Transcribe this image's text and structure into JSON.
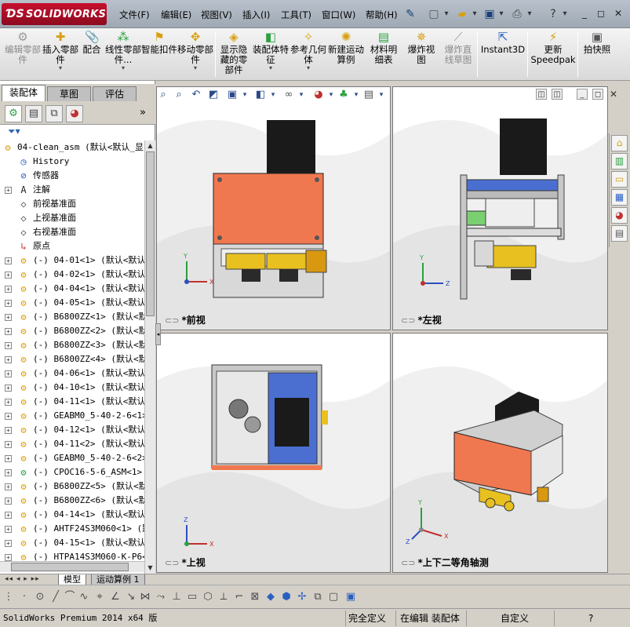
{
  "app": {
    "logo_text": "SOLIDWORKS",
    "menus": [
      "文件(F)",
      "编辑(E)",
      "视图(V)",
      "插入(I)",
      "工具(T)",
      "窗口(W)",
      "帮助(H)"
    ]
  },
  "quick_access": {
    "icons": [
      "pin-icon",
      "new-icon",
      "open-icon",
      "save-icon",
      "print-icon",
      "help-icon"
    ]
  },
  "window_controls": {
    "minimize": "_",
    "restore": "◻",
    "close": "✕"
  },
  "command_manager": [
    {
      "label": "编辑零部件",
      "icon": "edit-component-icon",
      "enabled": false,
      "dropdown": false
    },
    {
      "label": "插入零部件",
      "icon": "insert-component-icon",
      "enabled": true,
      "dropdown": true
    },
    {
      "label": "配合",
      "icon": "mate-icon",
      "enabled": true,
      "dropdown": false
    },
    {
      "label": "线性零部件...",
      "icon": "linear-pattern-icon",
      "enabled": true,
      "dropdown": true
    },
    {
      "label": "智能扣件",
      "icon": "smart-fasteners-icon",
      "enabled": true,
      "dropdown": false
    },
    {
      "label": "移动零部件",
      "icon": "move-component-icon",
      "enabled": true,
      "dropdown": true
    },
    {
      "label": "显示隐藏的零部件",
      "icon": "show-hidden-icon",
      "enabled": true,
      "dropdown": false
    },
    {
      "label": "装配体特征",
      "icon": "assembly-features-icon",
      "enabled": true,
      "dropdown": true
    },
    {
      "label": "参考几何体",
      "icon": "reference-geometry-icon",
      "enabled": true,
      "dropdown": true
    },
    {
      "label": "新建运动算例",
      "icon": "new-motion-study-icon",
      "enabled": true,
      "dropdown": false
    },
    {
      "label": "材料明细表",
      "icon": "bom-icon",
      "enabled": true,
      "dropdown": false
    },
    {
      "label": "爆炸视图",
      "icon": "exploded-view-icon",
      "enabled": true,
      "dropdown": false
    },
    {
      "label": "爆炸直线草图",
      "icon": "explode-line-sketch-icon",
      "enabled": false,
      "dropdown": false
    },
    {
      "label": "Instant3D",
      "icon": "instant3d-icon",
      "enabled": true,
      "dropdown": false
    },
    {
      "label": "更新Speedpak",
      "icon": "speedpak-icon",
      "enabled": true,
      "dropdown": false
    },
    {
      "label": "拍快照",
      "icon": "snapshot-icon",
      "enabled": true,
      "dropdown": false
    }
  ],
  "panel_tabs": [
    "装配体",
    "草图",
    "评估"
  ],
  "feature_tree": {
    "root": "04-clean_asm  (默认<默认_显",
    "items": [
      {
        "label": "History",
        "icon": "history-icon",
        "expandable": false
      },
      {
        "label": "传感器",
        "icon": "sensor-icon",
        "expandable": false
      },
      {
        "label": "注解",
        "icon": "annotation-icon",
        "expandable": true
      },
      {
        "label": "前视基准面",
        "icon": "plane-icon",
        "expandable": false
      },
      {
        "label": "上视基准面",
        "icon": "plane-icon",
        "expandable": false
      },
      {
        "label": "右视基准面",
        "icon": "plane-icon",
        "expandable": false
      },
      {
        "label": "原点",
        "icon": "origin-icon",
        "expandable": false
      },
      {
        "label": "(-) 04-01<1> (默认<默认",
        "icon": "part-icon",
        "expandable": true
      },
      {
        "label": "(-) 04-02<1> (默认<默认",
        "icon": "part-icon",
        "expandable": true
      },
      {
        "label": "(-) 04-04<1> (默认<默认",
        "icon": "part-icon",
        "expandable": true
      },
      {
        "label": "(-) 04-05<1> (默认<默认",
        "icon": "part-icon",
        "expandable": true
      },
      {
        "label": "(-) B6800ZZ<1> (默认<默",
        "icon": "part-icon",
        "expandable": true
      },
      {
        "label": "(-) B6800ZZ<2> (默认<默",
        "icon": "part-icon",
        "expandable": true
      },
      {
        "label": "(-) B6800ZZ<3> (默认<默",
        "icon": "part-icon",
        "expandable": true
      },
      {
        "label": "(-) B6800ZZ<4> (默认<默",
        "icon": "part-icon",
        "expandable": true
      },
      {
        "label": "(-) 04-06<1> (默认<默认",
        "icon": "part-icon",
        "expandable": true
      },
      {
        "label": "(-) 04-10<1> (默认<默认",
        "icon": "part-icon",
        "expandable": true
      },
      {
        "label": "(-) 04-11<1> (默认<默认",
        "icon": "part-icon",
        "expandable": true
      },
      {
        "label": "(-) GEABM0_5-40-2-6<1>",
        "icon": "part-icon",
        "expandable": true
      },
      {
        "label": "(-) 04-12<1> (默认<默认",
        "icon": "part-icon",
        "expandable": true
      },
      {
        "label": "(-) 04-11<2> (默认<默认",
        "icon": "part-icon",
        "expandable": true
      },
      {
        "label": "(-) GEABM0_5-40-2-6<2>",
        "icon": "part-icon",
        "expandable": true
      },
      {
        "label": "(-) CPOC16-5-6_ASM<1> (",
        "icon": "subassembly-icon",
        "expandable": true
      },
      {
        "label": "(-) B6800ZZ<5> (默认<默",
        "icon": "part-icon",
        "expandable": true
      },
      {
        "label": "(-) B6800ZZ<6> (默认<默",
        "icon": "part-icon",
        "expandable": true
      },
      {
        "label": "(-) 04-14<1> (默认<默认",
        "icon": "part-icon",
        "expandable": true
      },
      {
        "label": "(-) AHTF24S3M060<1> (默",
        "icon": "part-icon",
        "expandable": true
      },
      {
        "label": "(-) 04-15<1> (默认<默认",
        "icon": "part-icon",
        "expandable": true
      },
      {
        "label": "(-) HTPA14S3M060-K-P6<1",
        "icon": "part-icon",
        "expandable": true
      }
    ]
  },
  "viewports": [
    {
      "id": "front",
      "label": "*前视"
    },
    {
      "id": "left",
      "label": "*左视"
    },
    {
      "id": "top",
      "label": "*上视"
    },
    {
      "id": "iso",
      "label": "*上下二等角轴测"
    }
  ],
  "bottom_tabs": [
    "模型",
    "运动算例 1"
  ],
  "status_bar": {
    "app_version": "SolidWorks Premium 2014 x64 版",
    "state": "完全定义",
    "editing": "在编辑 装配体",
    "units": "自定义",
    "help": "?"
  },
  "colors": {
    "accent": "#c8102e",
    "copper_plate": "#f07850",
    "motor_black": "#1a1a1a",
    "blue_part": "#4a6fd0",
    "yellow_part": "#e8c020",
    "green_part": "#7ad070"
  }
}
